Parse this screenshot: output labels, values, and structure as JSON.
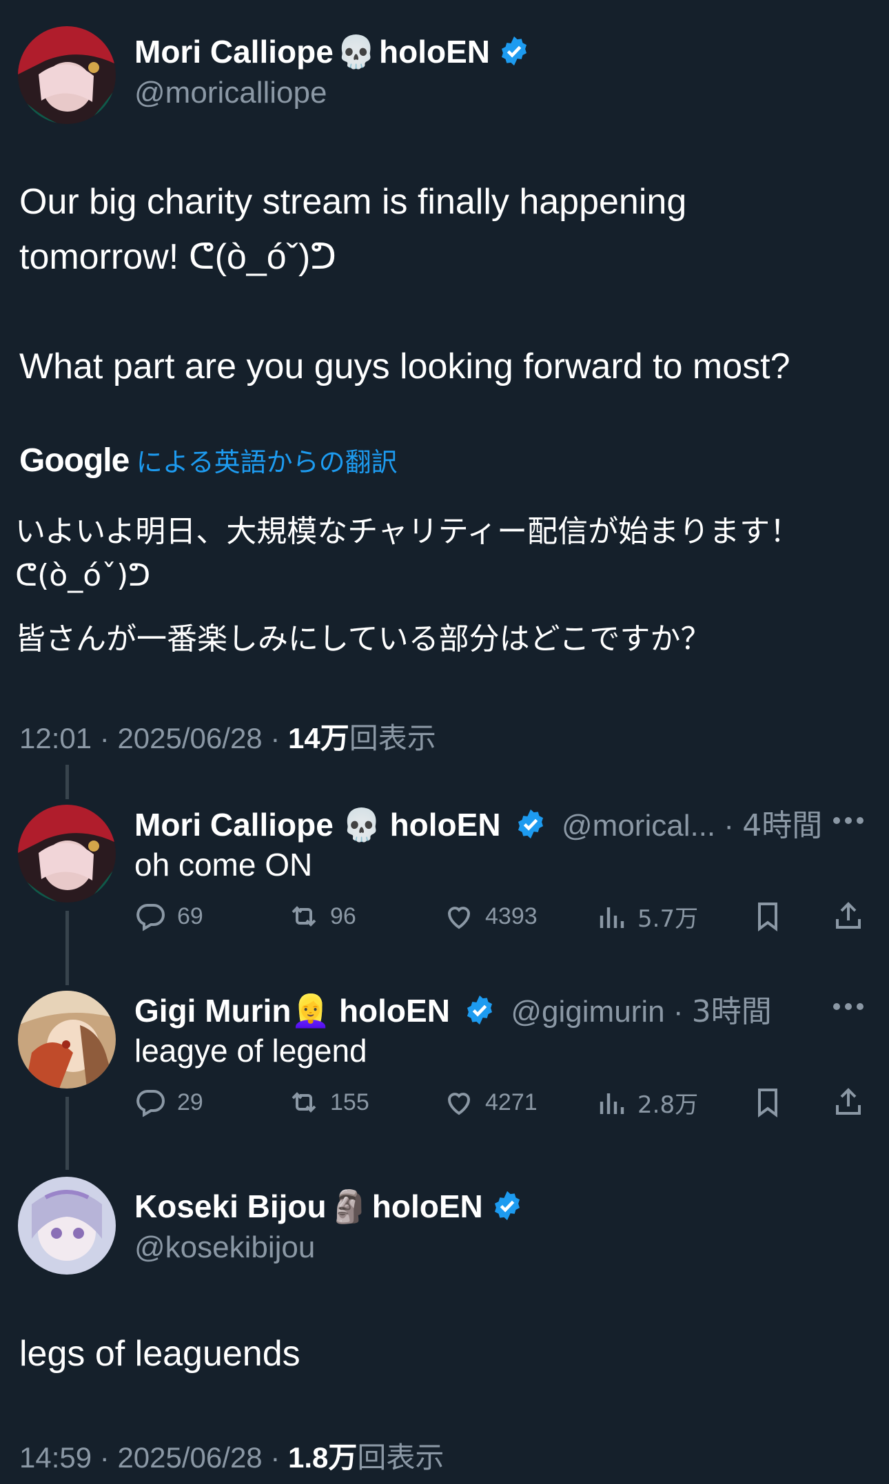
{
  "main_tweet": {
    "display_name": "Mori Calliope",
    "name_emoji": "💀",
    "name_suffix": "holoEN",
    "handle": "@moricalliope",
    "text_line1": "Our big charity stream is finally happening",
    "text_line2": "tomorrow! ᕦ(ò_óˇ)ᕤ",
    "text_line3": "What part are you guys looking forward to most?",
    "translation_brand": "Google",
    "translation_label": "による英語からの翻訳",
    "translated_line1": "いよいよ明日、大規模なチャリティー配信が始まります！",
    "translated_line2": "ᕦ(ò_óˇ)ᕤ",
    "translated_line3": "皆さんが一番楽しみにしている部分はどこですか？",
    "time": "12:01",
    "date": "2025/06/28",
    "views_count": "14万",
    "views_label": "回表示"
  },
  "replies": [
    {
      "display_name": "Mori Calliope",
      "name_emoji": "💀",
      "name_suffix": "holoEN",
      "handle": "@morical...",
      "time_ago": "4時間",
      "text": "oh come ON",
      "reply_count": "69",
      "retweet_count": "96",
      "like_count": "4393",
      "view_count": "5.7万"
    },
    {
      "display_name": "Gigi Murin",
      "name_emoji": "👱‍♀️",
      "name_suffix": "holoEN",
      "handle": "@gigimurin",
      "time_ago": "3時間",
      "text": "leagye of legend",
      "reply_count": "29",
      "retweet_count": "155",
      "like_count": "4271",
      "view_count": "2.8万"
    }
  ],
  "focus_tweet": {
    "display_name": "Koseki Bijou",
    "name_emoji": "🗿",
    "name_suffix": "holoEN",
    "handle": "@kosekibijou",
    "text": "legs of leaguends",
    "time": "14:59",
    "date": "2025/06/28",
    "views_count": "1.8万",
    "views_label": "回表示"
  },
  "separator": "·",
  "colors": {
    "background": "#15202b",
    "secondary_text": "#8b98a5",
    "verified_blue": "#1d9bf0",
    "link_blue": "#1d9bf0",
    "thread_line": "#38444d"
  },
  "icons": [
    "verified-badge-icon",
    "reply-icon",
    "retweet-icon",
    "like-icon",
    "views-icon",
    "bookmark-icon",
    "share-icon",
    "more-dots-icon"
  ]
}
